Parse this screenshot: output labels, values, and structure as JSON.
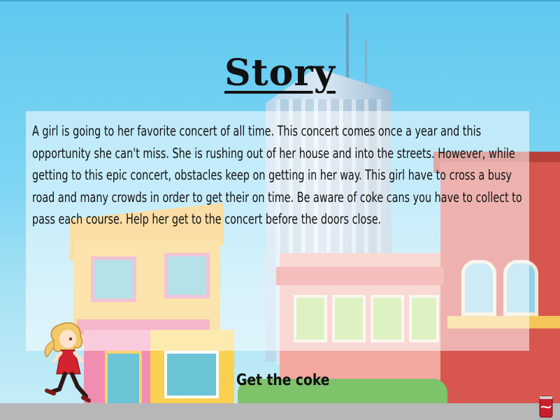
{
  "screen": {
    "title": "Story",
    "story_text": "A girl is going to her favorite concert of all time. This concert comes once a year and this opportunity she can't miss. She is rushing out of her house and into the streets. However, while getting to this epic concert, obstacles keep on getting in her way. This girl have to cross a busy road and many crowds in order to get their on time. Be aware of coke cans you have to collect to pass each course. Help her get to the concert before the doors close.",
    "objective_label": "Get the coke"
  },
  "icons": {
    "character": "girl-runner-icon",
    "collectible": "coke-can-icon"
  },
  "colors": {
    "sky": "#7fd6f4",
    "panel": "#ffffff8c",
    "text": "#111111"
  }
}
